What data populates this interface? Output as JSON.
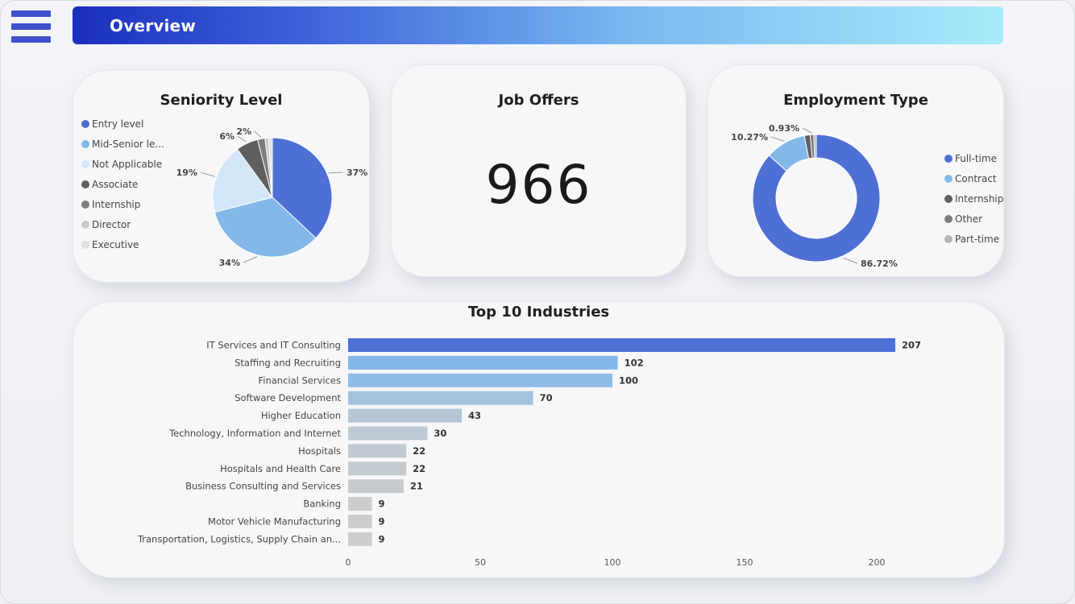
{
  "header": {
    "title": "Overview"
  },
  "menu": {
    "icon": "hamburger-menu-icon"
  },
  "colors": {
    "primary": "#4e6fd4",
    "light_blue": "#84b8ea",
    "pale_blue": "#d2e6f7",
    "dark_gray": "#5f5f5f",
    "mid_gray": "#7c7c7c",
    "light_gray": "#c9c9c9",
    "pale_gray": "#e0e0e0"
  },
  "cards": {
    "seniority": {
      "title": "Seniority Level"
    },
    "offers": {
      "title": "Job Offers",
      "value": "966"
    },
    "employment": {
      "title": "Employment Type"
    },
    "industries": {
      "title": "Top 10 Industries"
    }
  },
  "chart_data": [
    {
      "type": "pie",
      "title": "Seniority Level",
      "legend_position": "left",
      "categories": [
        "Entry level",
        "Mid-Senior le...",
        "Not Applicable",
        "Associate",
        "Internship",
        "Director",
        "Executive"
      ],
      "values": [
        37,
        34,
        19,
        6,
        2,
        1,
        1
      ],
      "data_labels": [
        "37%",
        "34%",
        "19%",
        "6%",
        "2%",
        "",
        ""
      ],
      "colors": [
        "#4e6fd4",
        "#84b8ea",
        "#d2e6f7",
        "#5f5f5f",
        "#7c7c7c",
        "#c9c9c9",
        "#e0e0e0"
      ]
    },
    {
      "type": "pie",
      "subtype": "donut",
      "title": "Employment Type",
      "legend_position": "right",
      "categories": [
        "Full-time",
        "Contract",
        "Internship",
        "Other",
        "Part-time"
      ],
      "values": [
        86.72,
        10.27,
        1.45,
        0.93,
        0.63
      ],
      "data_labels": [
        "86.72%",
        "10.27%",
        "",
        "0.93%",
        ""
      ],
      "colors": [
        "#4e6fd4",
        "#84b8ea",
        "#5f5f5f",
        "#7c7c7c",
        "#b4b4b4"
      ]
    },
    {
      "type": "bar",
      "orientation": "horizontal",
      "title": "Top 10 Industries",
      "categories": [
        "IT Services and IT Consulting",
        "Staffing and Recruiting",
        "Financial Services",
        "Software Development",
        "Higher Education",
        "Technology, Information and Internet",
        "Hospitals",
        "Hospitals and Health Care",
        "Business Consulting and Services",
        "Banking",
        "Motor Vehicle Manufacturing",
        "Transportation, Logistics, Supply Chain an..."
      ],
      "values": [
        207,
        102,
        100,
        70,
        43,
        30,
        22,
        22,
        21,
        9,
        9,
        9
      ],
      "colors": [
        "#4e6fd4",
        "#84b8ea",
        "#8fbde8",
        "#a3c2df",
        "#b4c6d6",
        "#bccad5",
        "#c1cad2",
        "#c3cad0",
        "#c7cbcf",
        "#cccccc",
        "#cdcdcd",
        "#cdcdcd"
      ],
      "xlim": [
        0,
        207
      ],
      "xticks": [
        0,
        50,
        100,
        150,
        200
      ],
      "xlabel": "",
      "ylabel": "",
      "grid": false
    }
  ]
}
